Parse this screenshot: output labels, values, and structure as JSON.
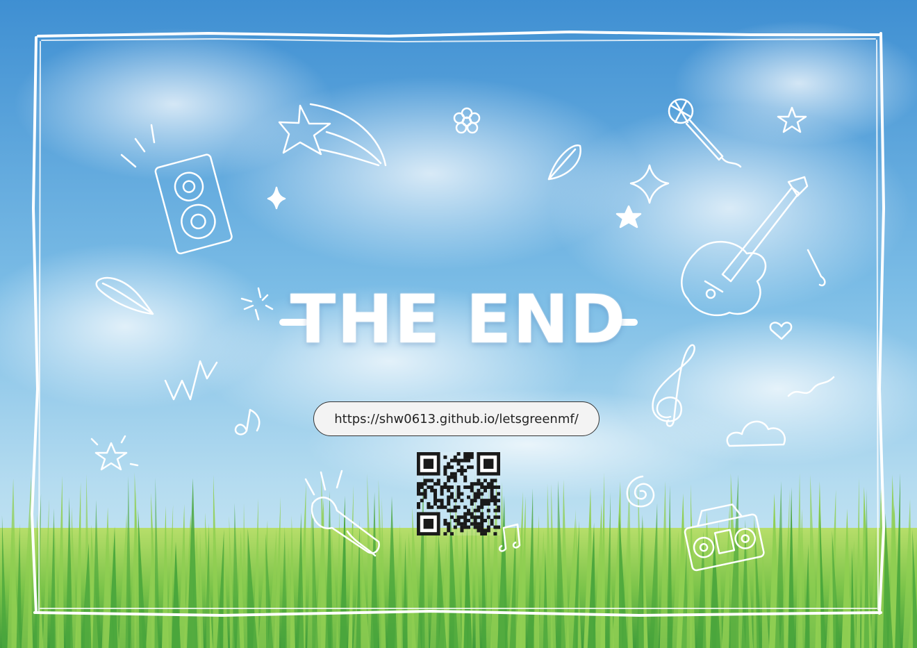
{
  "title": "THE END",
  "link_url": "https://shw0613.github.io/letsgreenmf/",
  "colors": {
    "sky_top": "#4a9ad6",
    "sky_light": "#c5e3f2",
    "grass_light": "#a6d65a",
    "grass_dark": "#3d9a36",
    "doodle": "#ffffff",
    "pill_bg": "#f3f3f3"
  },
  "icons": [
    "speaker-icon",
    "shooting-star-icon",
    "flower-icon",
    "leaf-icon",
    "microphone-icon",
    "star-icon",
    "sparkle-icon",
    "guitar-icon",
    "music-note-icon",
    "treble-clef-icon",
    "heart-icon",
    "cloud-icon",
    "zigzag-icon",
    "trumpet-icon",
    "spiral-icon",
    "boombox-icon",
    "qr-code"
  ]
}
